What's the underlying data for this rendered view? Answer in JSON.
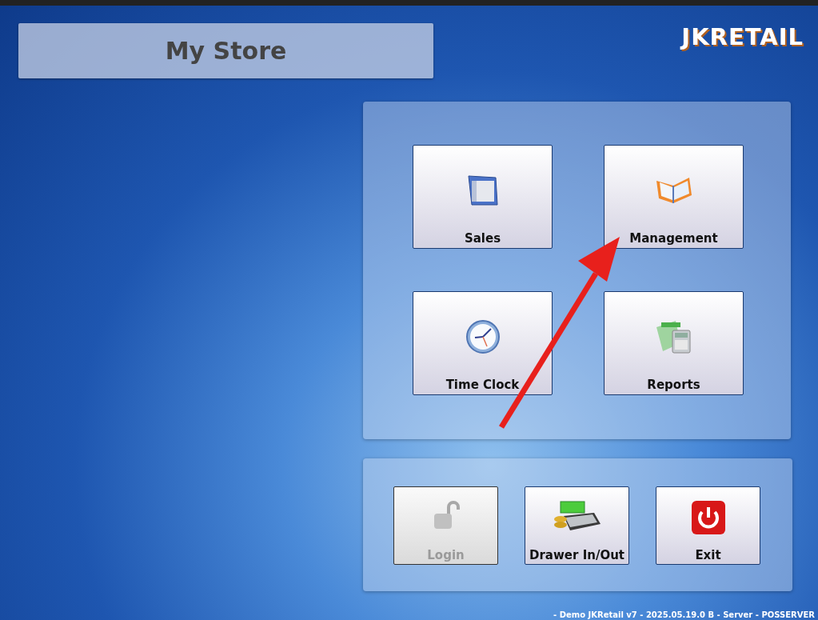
{
  "store_title": "My Store",
  "logo": "JKRETAIL",
  "main_menu": [
    {
      "label": "Sales"
    },
    {
      "label": "Management"
    },
    {
      "label": "Time Clock"
    },
    {
      "label": "Reports"
    }
  ],
  "actions": [
    {
      "label": "Login",
      "disabled": true
    },
    {
      "label": "Drawer In/Out",
      "disabled": false
    },
    {
      "label": "Exit",
      "disabled": false
    }
  ],
  "status_bar": "- Demo JKRetail v7 - 2025.05.19.0 B - Server - POSSERVER"
}
